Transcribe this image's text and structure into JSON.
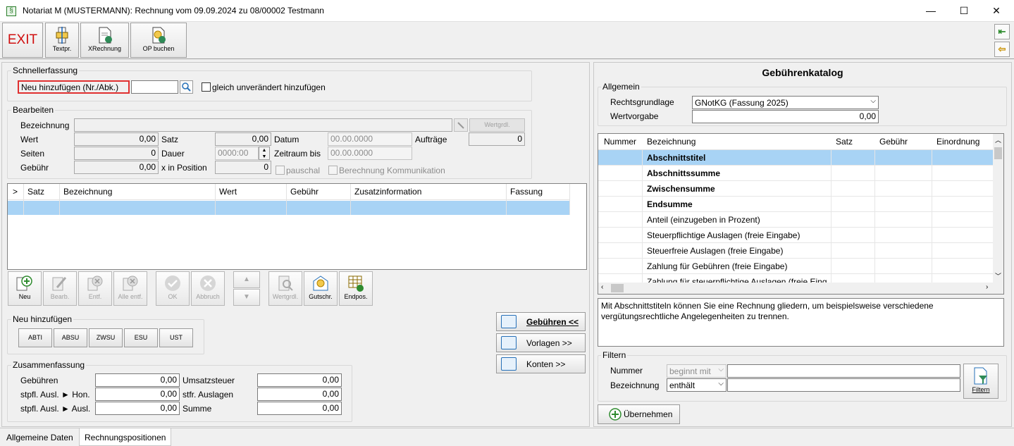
{
  "window": {
    "title": "Notariat M (MUSTERMANN): Rechnung vom 09.09.2024 zu 08/00002 Testmann",
    "app_icon": "§",
    "minimize": "—",
    "maximize": "☐",
    "close": "✕"
  },
  "toolbar": {
    "exit_label": "EXIT",
    "textpr_label": "Textpr.",
    "xrechnung_label": "XRechnung",
    "op_buchen_label": "OP buchen"
  },
  "schnell": {
    "group_label": "Schnellerfassung",
    "neu_label": "Neu hinzufügen (Nr./Abk.)",
    "input_value": "",
    "checkbox_label": "gleich unverändert hinzufügen"
  },
  "bearbeiten": {
    "group_label": "Bearbeiten",
    "bezeichnung_label": "Bezeichnung",
    "bezeichnung_value": "",
    "wertgrdl_label": "Wertgrdl.",
    "wert_label": "Wert",
    "wert_value": "0,00",
    "satz_label": "Satz",
    "satz_value": "0,00",
    "datum_label": "Datum",
    "datum_value": "00.00.0000",
    "auftraege_label": "Aufträge",
    "auftraege_value": "0",
    "seiten_label": "Seiten",
    "seiten_value": "0",
    "dauer_label": "Dauer",
    "dauer_value": "0000:00",
    "zeitraum_label": "Zeitraum bis",
    "zeitraum_value": "00.00.0000",
    "gebuehr_label": "Gebühr",
    "gebuehr_value": "0,00",
    "xpos_label": "x in Position",
    "xpos_value": "0",
    "pauschal_label": "pauschal",
    "berechnung_label": "Berechnung Kommunikation"
  },
  "positions": {
    "columns": [
      ">",
      "Satz",
      "Bezeichnung",
      "Wert",
      "Gebühr",
      "Zusatzinformation",
      "Fassung"
    ]
  },
  "actions": {
    "neu": "Neu",
    "bearb": "Bearb.",
    "entf": "Entf.",
    "alle_entf": "Alle entf.",
    "ok": "OK",
    "abbruch": "Abbruch",
    "wertgrdl": "Wertgrdl.",
    "gutschr": "Gutschr.",
    "endpos": "Endpos."
  },
  "neu_hinzu": {
    "group_label": "Neu hinzufügen",
    "buttons": [
      "ABTI",
      "ABSU",
      "ZWSU",
      "ESU",
      "UST"
    ]
  },
  "side_buttons": {
    "gebuehren": "Gebühren <<",
    "vorlagen": "Vorlagen >>",
    "konten": "Konten >>"
  },
  "zusammen": {
    "group_label": "Zusammenfassung",
    "gebuehren_label": "Gebühren",
    "gebuehren_value": "0,00",
    "hon_label": "stpfl. Ausl. ► Hon.",
    "hon_value": "0,00",
    "ausl_label": "stpfl. Ausl. ► Ausl.",
    "ausl_value": "0,00",
    "ust_label": "Umsatzsteuer",
    "ust_value": "0,00",
    "stfr_label": "stfr. Auslagen",
    "stfr_value": "0,00",
    "summe_label": "Summe",
    "summe_value": "0,00"
  },
  "tabs": [
    "Allgemeine Daten",
    "Rechnungspositionen"
  ],
  "catalog": {
    "title": "Gebührenkatalog",
    "allgemein_label": "Allgemein",
    "rechtsgrundlage_label": "Rechtsgrundlage",
    "rechtsgrundlage_value": "GNotKG (Fassung 2025)",
    "wertvorgabe_label": "Wertvorgabe",
    "wertvorgabe_value": "0,00",
    "columns": [
      "Nummer",
      "Bezeichnung",
      "Satz",
      "Gebühr",
      "Einordnung"
    ],
    "rows": [
      {
        "bez": "Abschnittstitel",
        "bold": true
      },
      {
        "bez": "Abschnittssumme",
        "bold": true
      },
      {
        "bez": "Zwischensumme",
        "bold": true
      },
      {
        "bez": "Endsumme",
        "bold": true
      },
      {
        "bez": "Anteil (einzugeben in Prozent)",
        "bold": false
      },
      {
        "bez": "Steuerpflichtige Auslagen (freie Eingabe)",
        "bold": false
      },
      {
        "bez": "Steuerfreie Auslagen (freie Eingabe)",
        "bold": false
      },
      {
        "bez": "Zahlung für Gebühren (freie Eingabe)",
        "bold": false
      },
      {
        "bez": "Zahlung für steuerpflichtige Auslagen (freie Eing",
        "bold": false
      }
    ],
    "description": "Mit Abschnittstiteln können Sie eine Rechnung gliedern, um beispielsweise verschiedene vergütungsrechtliche Angelegenheiten zu trennen.",
    "filter_label": "Filtern",
    "nummer_label": "Nummer",
    "nummer_mode": "beginnt mit",
    "bezeichnung_label": "Bezeichnung",
    "bezeichnung_mode": "enthält",
    "filter_button": "Filtern",
    "uebernehmen_button": "Übernehmen"
  }
}
